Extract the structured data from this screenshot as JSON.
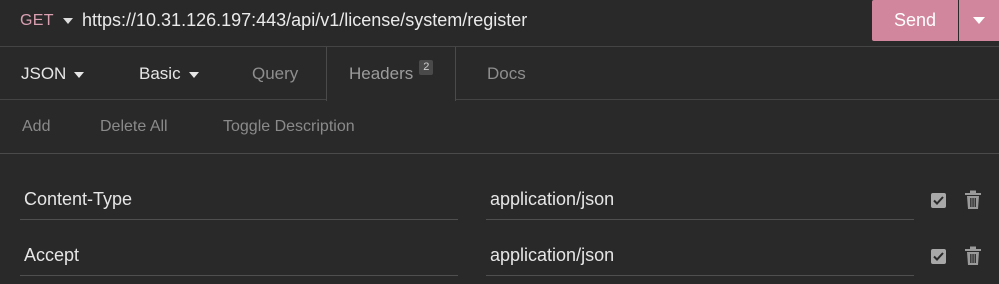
{
  "request": {
    "method": "GET",
    "url": "https://10.31.126.197:443/api/v1/license/system/register",
    "send_label": "Send"
  },
  "tabs": {
    "body_format": "JSON",
    "auth": "Basic",
    "query": "Query",
    "headers": "Headers",
    "headers_count": "2",
    "docs": "Docs"
  },
  "actions": {
    "add": "Add",
    "delete_all": "Delete All",
    "toggle_description": "Toggle Description"
  },
  "headers": [
    {
      "name": "Content-Type",
      "value": "application/json",
      "enabled": true
    },
    {
      "name": "Accept",
      "value": "application/json",
      "enabled": true
    }
  ],
  "colors": {
    "accent": "#d2869d",
    "method": "#d9a0b2",
    "background": "#292929"
  }
}
